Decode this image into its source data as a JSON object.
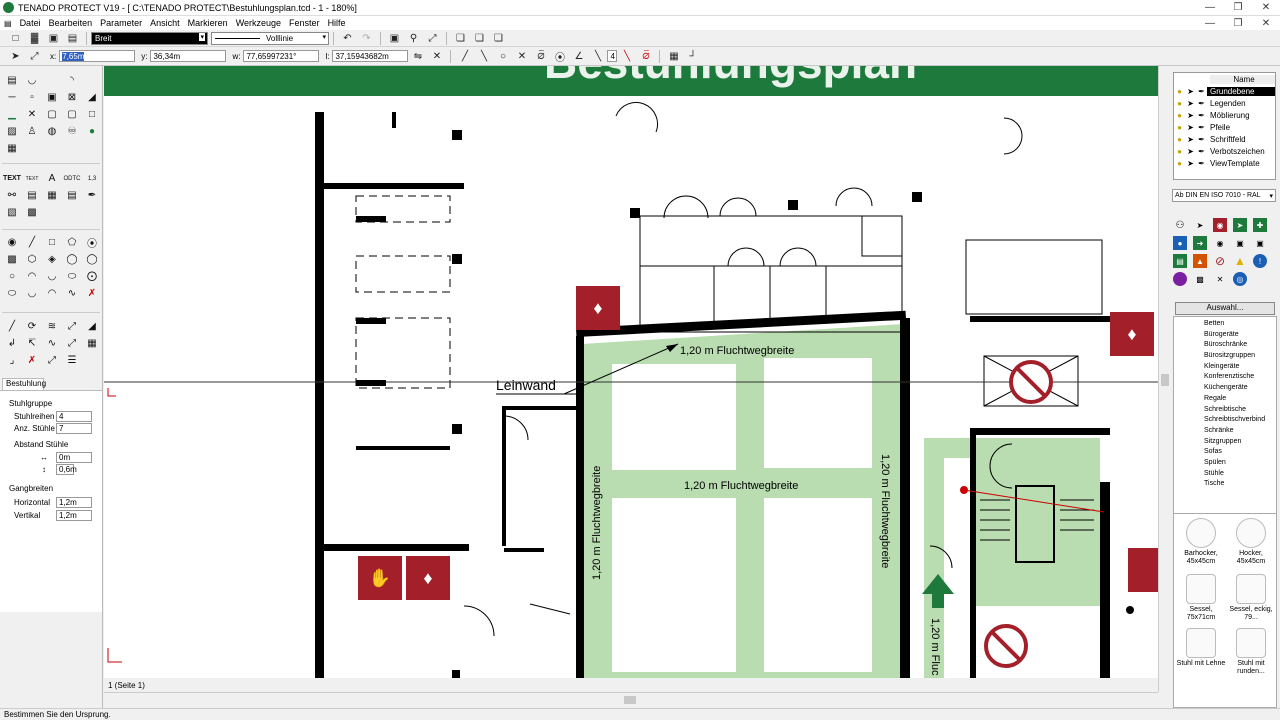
{
  "window": {
    "title": "TENADO PROTECT V19 - [ C:\\TENADO PROTECT\\Bestuhlungsplan.tcd - 1 - 180%]"
  },
  "menu": [
    "Datei",
    "Bearbeiten",
    "Parameter",
    "Ansicht",
    "Markieren",
    "Werkzeuge",
    "Fenster",
    "Hilfe"
  ],
  "toolbar": {
    "line_width": "Breit",
    "line_style": "Volllinie"
  },
  "coords": {
    "x_label": "x:",
    "x": "7,65m",
    "y_label": "y:",
    "y": "36,34m",
    "w_label": "w:",
    "w": "77,65997231°",
    "l_label": "l:",
    "l": "37,15943682m",
    "n": "4"
  },
  "bestuhlung": {
    "tab": "Bestuhlung",
    "group": "Stuhlgruppe",
    "rows_label": "Stuhlreihen",
    "rows": "4",
    "chairs_label": "Anz. Stühle",
    "chairs": "7",
    "distance_label": "Abstand Stühle",
    "dist_h": "0m",
    "dist_v": "0,6m",
    "aisles_label": "Gangbreiten",
    "horiz_label": "Horizontal",
    "horiz": "1,2m",
    "vert_label": "Vertikal",
    "vert": "1,2m"
  },
  "canvas": {
    "banner_text": "Bestuhlungsplan",
    "label_leinwand": "Leinwand",
    "label_top": "1,20 m Fluchtwegbreite",
    "label_mid": "1,20 m Fluchtwegbreite",
    "label_left": "1,20 m Fluchtwegbreite",
    "label_right": "1,20 m Fluchtwegbreite",
    "label_corridor": "1,20 m Fluc"
  },
  "page_tab": "1 (Seite 1)",
  "status": "Bestimmen Sie den Ursprung.",
  "layers": {
    "header": "Name",
    "items": [
      {
        "name": "Grundebene",
        "selected": true
      },
      {
        "name": "Legenden",
        "selected": false
      },
      {
        "name": "Möblierung",
        "selected": false
      },
      {
        "name": "Pfeile",
        "selected": false
      },
      {
        "name": "Schriftfeld",
        "selected": false
      },
      {
        "name": "Verbotszeichen",
        "selected": false
      },
      {
        "name": "ViewTemplate",
        "selected": false
      }
    ]
  },
  "library": {
    "standard": "Ab DIN EN ISO 7010 - RAL",
    "select_button": "Auswahl..."
  },
  "tree": [
    "Betten",
    "Bürogeräte",
    "Büroschränke",
    "Bürositzgruppen",
    "Kleingeräte",
    "Konferenztische",
    "Küchengeräte",
    "Regale",
    "Schreibtische",
    "Schreibtischverbind",
    "Schränke",
    "Sitzgruppen",
    "Sofas",
    "Spülen",
    "Stühle",
    "Tische"
  ],
  "thumbs": [
    {
      "name": "Barhocker, 45x45cm"
    },
    {
      "name": "Hocker, 45x45cm"
    },
    {
      "name": "Sessel, 75x71cm"
    },
    {
      "name": "Sessel, eckig, 79..."
    },
    {
      "name": "Stuhl mit Lehne"
    },
    {
      "name": "Stuhl mit runden..."
    }
  ],
  "colors": {
    "green_banner": "#1e7a3c",
    "escape_green": "#b9dcb0",
    "sign_red": "#a3202a"
  }
}
